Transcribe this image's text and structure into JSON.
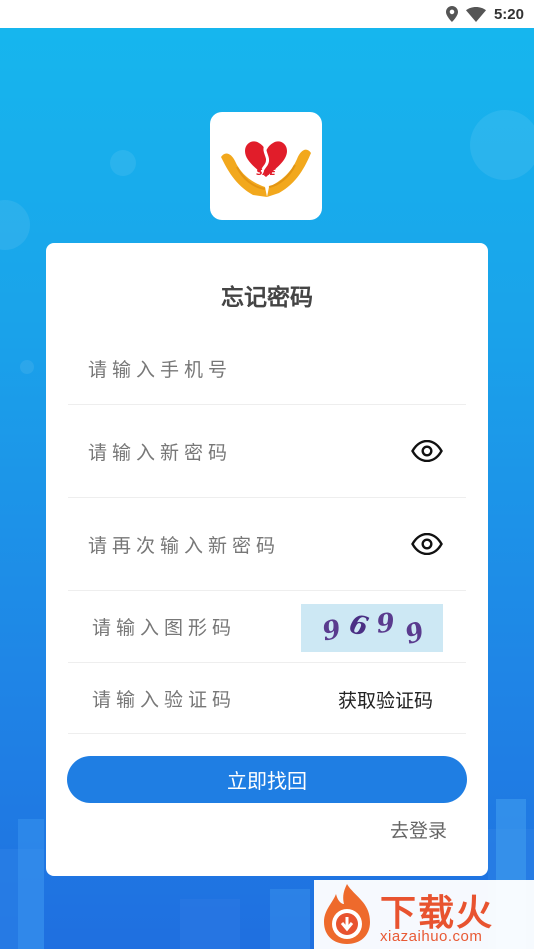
{
  "status_bar": {
    "time": "5:20",
    "icons": [
      "location-icon",
      "wifi-icon",
      "battery-icon"
    ]
  },
  "app": {
    "logo_text": "SAE"
  },
  "form": {
    "title": "忘记密码",
    "phone_placeholder": "请输入手机号",
    "new_password_placeholder": "请输入新密码",
    "confirm_password_placeholder": "请再次输入新密码",
    "captcha_placeholder": "请输入图形码",
    "captcha_digits": [
      "9",
      "6",
      "9",
      "9"
    ],
    "sms_code_placeholder": "请输入验证码",
    "get_code_label": "获取验证码",
    "submit_label": "立即找回",
    "login_link_label": "去登录"
  },
  "watermark": {
    "title": "下载火",
    "subtitle": "xiazaihuo.com"
  },
  "colors": {
    "primary": "#1f7ee3",
    "bg_top": "#16b8ee",
    "bg_bottom": "#1f6fe0",
    "watermark": "#e8532f"
  }
}
